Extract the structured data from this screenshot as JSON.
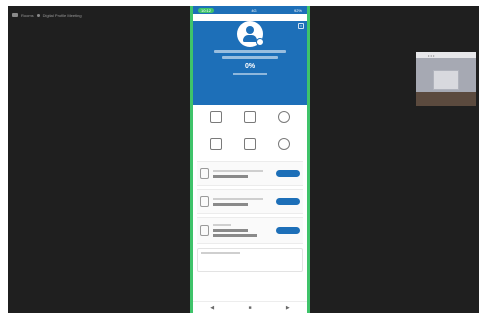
{
  "window": {
    "breadcrumb_a": "Rooms",
    "breadcrumb_b": "Digital Profile Meeting"
  },
  "phone": {
    "status": {
      "time_pill": "10:12",
      "left_text": "4G",
      "right_text": "92%"
    },
    "profile": {
      "percent": "0%",
      "close_glyph": "×"
    },
    "grid_icons": [
      {
        "icon": "grid-icon"
      },
      {
        "icon": "card-icon"
      },
      {
        "icon": "gear-icon"
      },
      {
        "icon": "document-icon"
      },
      {
        "icon": "mail-icon"
      },
      {
        "icon": "question-icon"
      }
    ],
    "cards": [
      {
        "icon": "id-card-icon"
      },
      {
        "icon": "phone-icon"
      },
      {
        "icon": "list-icon"
      }
    ],
    "navbar": {
      "back_glyph": "◀",
      "home_glyph": "■",
      "recent_glyph": "▶"
    }
  },
  "pip": {
    "bar_glyph": "• • •"
  }
}
